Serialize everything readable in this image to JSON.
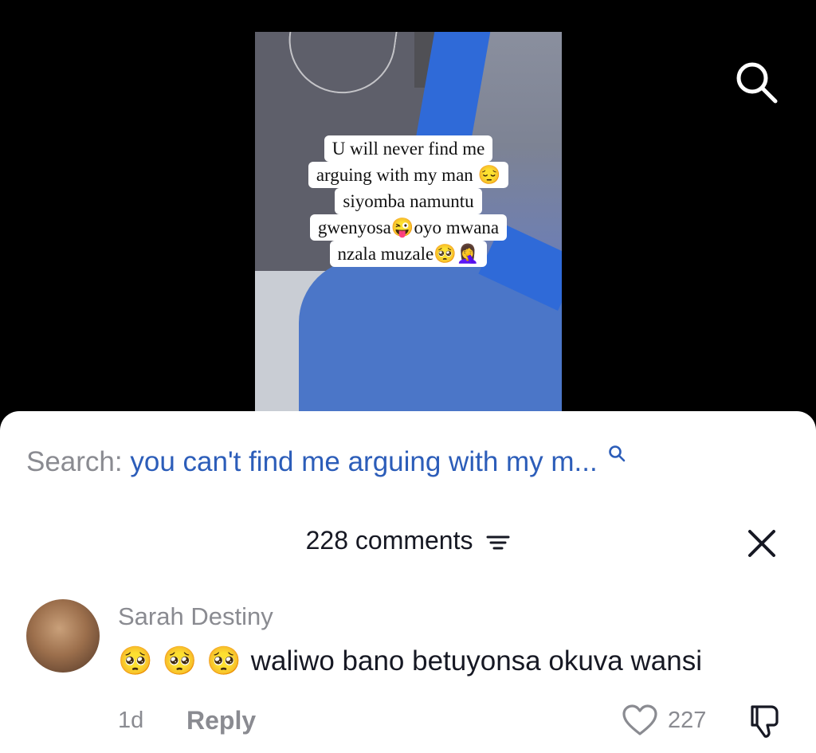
{
  "video": {
    "caption_lines": [
      "U will never find me",
      "arguing with my man 😔",
      "siyomba namuntu",
      "gwenyosa😜oyo mwana",
      "nzala muzale🥺🤦‍♀️"
    ]
  },
  "search": {
    "label": "Search:",
    "query": "you can't find me arguing with my m..."
  },
  "comments_header": {
    "count_label": "228 comments"
  },
  "comment": {
    "username": "Sarah Destiny",
    "emojis": [
      "🥺",
      "🥺",
      "🥺"
    ],
    "text": "waliwo bano betuyonsa okuva wansi",
    "time": "1d",
    "reply_label": "Reply",
    "likes": "227"
  },
  "colors": {
    "query_blue": "#2c5db9",
    "muted_gray": "#8a8b91",
    "text_dark": "#161823"
  },
  "icons": [
    "search-icon",
    "sort-icon",
    "close-icon",
    "heart-icon",
    "dislike-icon"
  ]
}
